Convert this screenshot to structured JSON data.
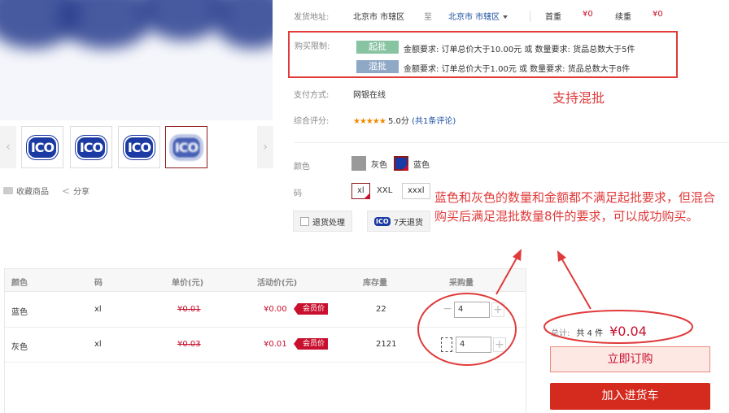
{
  "thumbnails": [
    {
      "text": "ICO"
    },
    {
      "text": "ICO"
    },
    {
      "text": "ICO"
    },
    {
      "text": "ICO",
      "selected": true
    }
  ],
  "fav_label": "收藏商品",
  "share_label": "分享",
  "shipping": {
    "label": "发货地址:",
    "from": "北京市 市辖区",
    "to_label": "至",
    "to": "北京市 市辖区",
    "first_weight_label": "首重",
    "first_weight_value": "¥0",
    "continued_weight_label": "续重",
    "continued_weight_value": "¥0"
  },
  "purchase_limit": {
    "label": "购买限制:",
    "rules": [
      {
        "tag": "起批",
        "text": "金额要求: 订单总价大于10.00元 或 数量要求: 货品总数大于5件",
        "color": "#88c4a2"
      },
      {
        "tag": "混批",
        "text": "金额要求: 订单总价大于1.00元 或 数量要求: 货品总数大于8件",
        "color": "#8fa8c6"
      }
    ]
  },
  "annotation_mix": "支持混批",
  "payment": {
    "label": "支付方式:",
    "value": "网银在线"
  },
  "rating": {
    "label": "综合评分:",
    "stars": "★★★★★",
    "score": "5.0分",
    "reviews": "(共1条评论)"
  },
  "color_option": {
    "label": "颜色",
    "options": [
      {
        "name": "灰色",
        "color": "#999999"
      },
      {
        "name": "蓝色",
        "color": "#1a3aa6",
        "selected": true
      }
    ]
  },
  "size_option": {
    "label": "码",
    "options": [
      {
        "name": "xl",
        "selected": true
      },
      {
        "name": "XXL"
      },
      {
        "name": "xxxl"
      }
    ]
  },
  "services": [
    {
      "label": "退货处理"
    },
    {
      "label": "7天退货",
      "logo": "ICO"
    }
  ],
  "annotation_big": "蓝色和灰色的数量和金额都不满足起批要求，但混合购买后满足混批数量8件的要求，可以成功购买。",
  "table": {
    "headers": [
      "颜色",
      "码",
      "单价(元)",
      "活动价(元)",
      "库存量",
      "采购量"
    ],
    "rows": [
      {
        "color": "蓝色",
        "size": "xl",
        "unit_price": "¥0.01",
        "promo_price": "¥0.00",
        "badge": "会员价",
        "stock": "22",
        "quantity": "4"
      },
      {
        "color": "灰色",
        "size": "xl",
        "unit_price": "¥0.03",
        "promo_price": "¥0.01",
        "badge": "会员价",
        "stock": "2121",
        "quantity": "4"
      }
    ]
  },
  "summary": {
    "label": "总计:",
    "count": "共 4 件",
    "amount": "¥0.04",
    "order_button": "立即订购",
    "cart_button": "加入进货车"
  },
  "colors": {
    "accent_red": "#c8102e",
    "annotation_red": "#e03a3a",
    "link_blue": "#1a4fa0"
  }
}
